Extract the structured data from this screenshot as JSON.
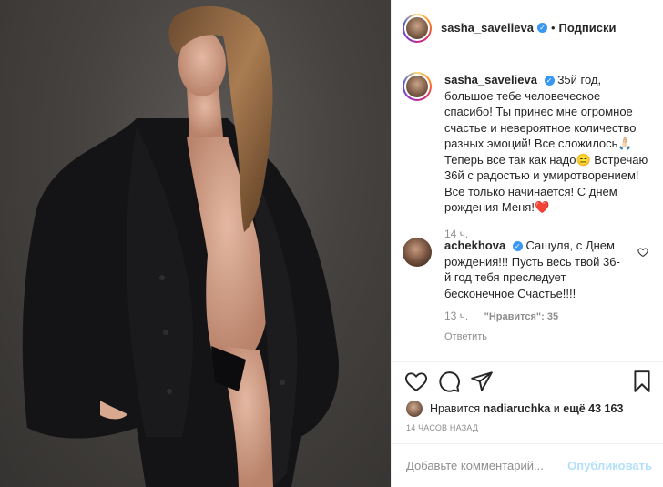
{
  "header": {
    "username": "sasha_savelieva",
    "separator": "•",
    "follow_label": "Подписки"
  },
  "caption": {
    "username": "sasha_savelieva",
    "text": "35й год, большое тебе человеческое спасибо! Ты принес мне огромное счастье и невероятное количество разных эмоций! Все сложилось🙏🏻 Теперь все так как надо😑 Встречаю 36й с радостью и умиротворением! Все только начинается! С днем рождения Меня!❤️",
    "time": "14 ч."
  },
  "comment": {
    "username": "achekhova",
    "text": "Сашуля, с Днем рождения!!! Пусть весь твой 36-й год тебя преследует бесконечное Счастье!!!!",
    "time": "13 ч.",
    "likes": "\"Нравится\": 35",
    "reply_label": "Ответить"
  },
  "likes_line": {
    "prefix": "Нравится",
    "user": "nadiaruchka",
    "and": "и",
    "others": "ещё 43 163"
  },
  "posted_time": "14 ЧАСОВ НАЗАД",
  "add_comment": {
    "placeholder": "Добавьте комментарий...",
    "publish_label": "Опубликовать"
  },
  "icons": {
    "verified": "verified-badge-icon",
    "like": "heart-icon",
    "comment": "comment-bubble-icon",
    "share": "paper-plane-icon",
    "save": "bookmark-icon"
  },
  "colors": {
    "accent": "#3897f0",
    "publish_disabled": "#b2dffc",
    "muted": "#8e8e8e"
  }
}
